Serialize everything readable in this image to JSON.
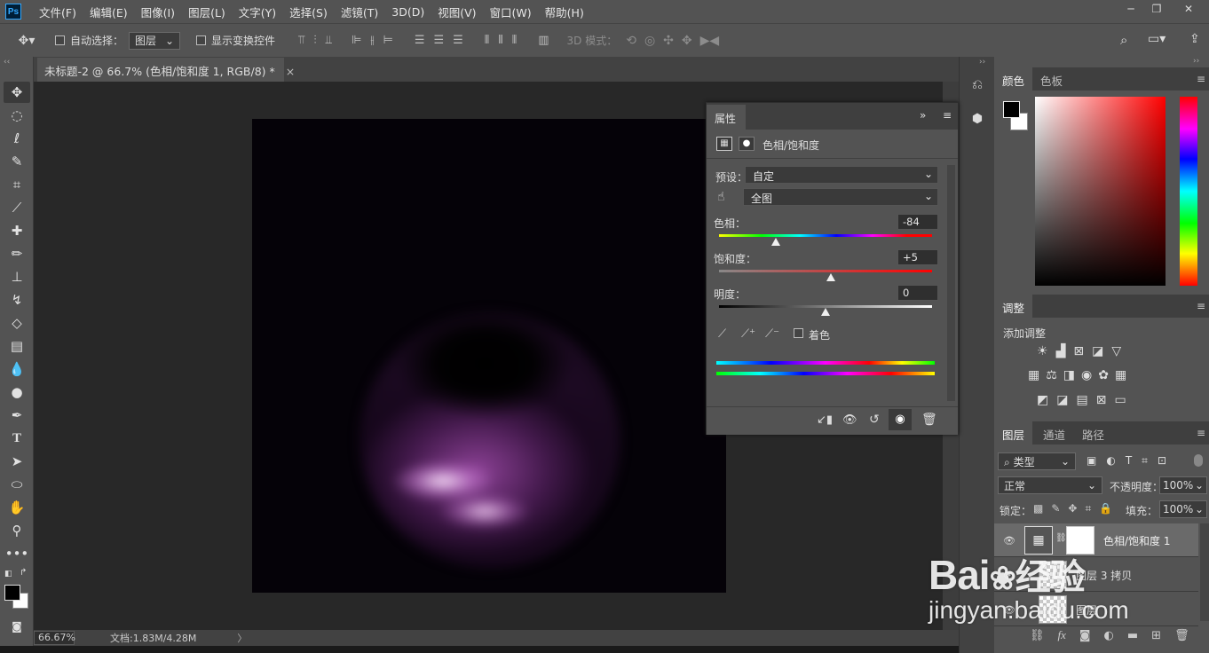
{
  "menubar": {
    "app_icon": "Ps",
    "items": [
      "文件(F)",
      "编辑(E)",
      "图像(I)",
      "图层(L)",
      "文字(Y)",
      "选择(S)",
      "滤镜(T)",
      "3D(D)",
      "视图(V)",
      "窗口(W)",
      "帮助(H)"
    ]
  },
  "options": {
    "auto_select_label": "自动选择：",
    "auto_select_target": "图层",
    "show_transform_label": "显示变换控件",
    "mode3d_label": "3D 模式："
  },
  "document": {
    "tab_title": "未标题-2 @ 66.7% (色相/饱和度 1, RGB/8) *",
    "close_glyph": "×"
  },
  "status": {
    "zoom": "66.67%",
    "doc_info": "文档:1.83M/4.28M",
    "arrow": "〉"
  },
  "properties": {
    "tab": "属性",
    "collapse": "»",
    "adjustment_name": "色相/饱和度",
    "preset_label": "预设：",
    "preset_value": "自定",
    "channel_value": "全图",
    "hue_label": "色相：",
    "hue_value": "-84",
    "hue_level": -84,
    "saturation_label": "饱和度：",
    "saturation_value": "+5",
    "saturation_level": 5,
    "lightness_label": "明度：",
    "lightness_value": "0",
    "lightness_level": 0,
    "colorize_label": "着色"
  },
  "color_panel": {
    "tabs": [
      "颜色",
      "色板"
    ],
    "foreground": "#000000",
    "background": "#ffffff",
    "hue_color": "#ff0000"
  },
  "adjustments_panel": {
    "tab": "调整",
    "add_label": "添加调整"
  },
  "layers_panel": {
    "tabs": [
      "图层",
      "通道",
      "路径"
    ],
    "filter_label": "类型",
    "blend_mode": "正常",
    "opacity_label": "不透明度：",
    "opacity_value": "100%",
    "lock_label": "锁定：",
    "fill_label": "填充：",
    "fill_value": "100%",
    "layers": [
      {
        "name": "色相/饱和度 1"
      },
      {
        "name": "图层 3 拷贝"
      },
      {
        "name": "图层"
      }
    ],
    "footer_fx": "fx"
  },
  "watermark": {
    "brand": "Bai",
    "brand_cn": "经验",
    "url": "jingyan.baidu.com"
  },
  "accent": {
    "selection_blue": "#31a8ff",
    "panel_bg": "#535353"
  }
}
